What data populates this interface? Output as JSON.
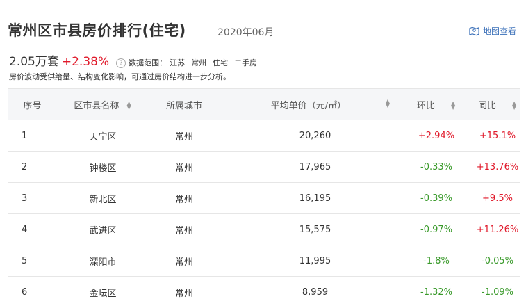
{
  "header": {
    "title": "常州区市县房价排行(住宅)",
    "date": "2020年06月",
    "map_link": "地图查看"
  },
  "stats": {
    "price": "2.05万套",
    "change": "+2.38%",
    "scope_label": "数据范围：",
    "scope_items": [
      "江苏",
      "常州",
      "住宅",
      "二手房"
    ]
  },
  "note": "房价波动受供给量、结构变化影响，可通过房价结构进一步分析。",
  "table": {
    "headers": [
      "序号",
      "区市县名称",
      "所属城市",
      "平均单价（元/㎡）",
      "环比",
      "同比"
    ],
    "rows": [
      {
        "rank": "1",
        "district": "天宁区",
        "city": "常州",
        "price": "20,260",
        "mom": "+2.94%",
        "yoy": "+15.1%"
      },
      {
        "rank": "2",
        "district": "钟楼区",
        "city": "常州",
        "price": "17,965",
        "mom": "-0.33%",
        "yoy": "+13.76%"
      },
      {
        "rank": "3",
        "district": "新北区",
        "city": "常州",
        "price": "16,195",
        "mom": "-0.39%",
        "yoy": "+9.5%"
      },
      {
        "rank": "4",
        "district": "武进区",
        "city": "常州",
        "price": "15,575",
        "mom": "-0.97%",
        "yoy": "+11.26%"
      },
      {
        "rank": "5",
        "district": "溧阳市",
        "city": "常州",
        "price": "11,995",
        "mom": "-1.8%",
        "yoy": "-0.05%"
      },
      {
        "rank": "6",
        "district": "金坛区",
        "city": "常州",
        "price": "8,959",
        "mom": "-1.32%",
        "yoy": "-1.09%"
      }
    ]
  },
  "colors": {
    "up": "#e0192a",
    "down": "#3a9a2b",
    "link": "#3a6fb8"
  }
}
